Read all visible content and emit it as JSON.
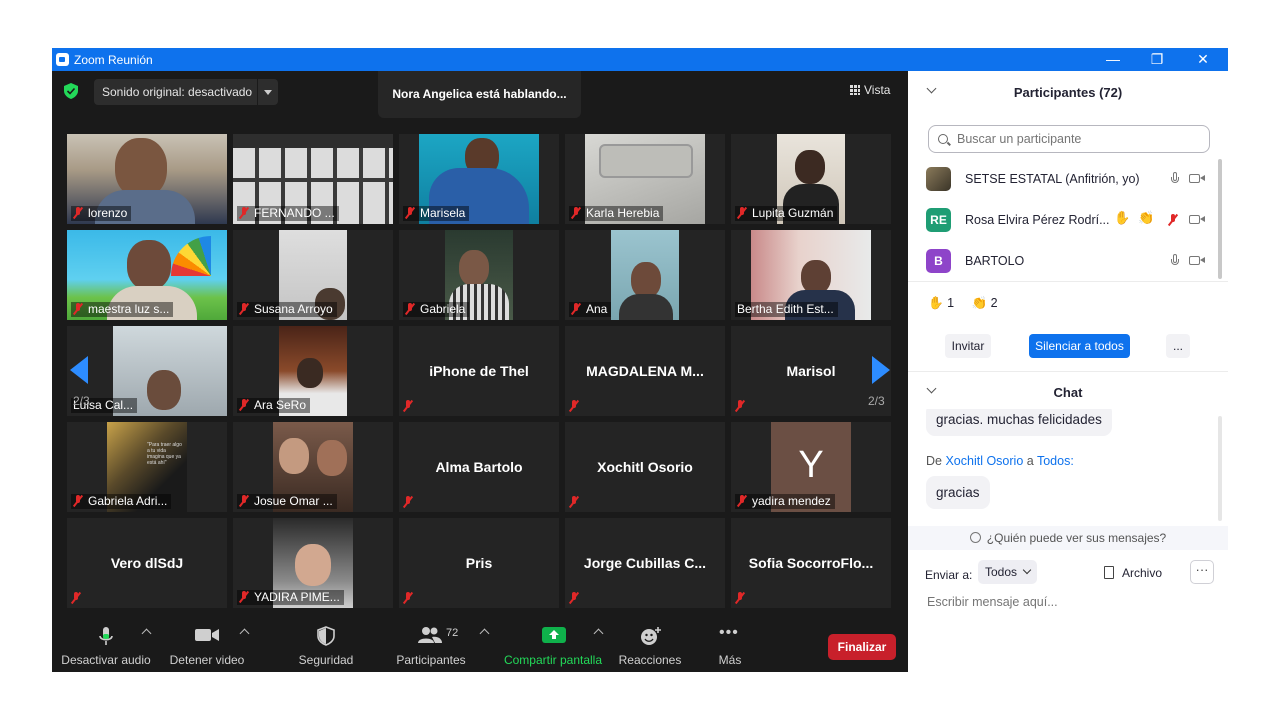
{
  "window": {
    "title": "Zoom Reunión",
    "minimize": "—",
    "restore": "❐",
    "close": "✕"
  },
  "meeting": {
    "original_sound": "Sonido original: desactivado",
    "speaking_banner": "Nora Angelica está hablando...",
    "view_label": "Vista",
    "page_left": "2/3",
    "page_right": "2/3"
  },
  "tiles": [
    {
      "name": "lorenzo"
    },
    {
      "name": "FERNANDO ..."
    },
    {
      "name": "Marisela"
    },
    {
      "name": "Karla Herebia"
    },
    {
      "name": "Lupita Guzmán"
    },
    {
      "name": "maestra luz s..."
    },
    {
      "name": "Susana Arroyo"
    },
    {
      "name": "Gabriela"
    },
    {
      "name": "Ana"
    },
    {
      "name": "Bertha Edith Est..."
    },
    {
      "name": "Luisa Cal..."
    },
    {
      "name": "Ara SeRo"
    },
    {
      "name": "iPhone de Thel"
    },
    {
      "name": "MAGDALENA M..."
    },
    {
      "name": "Marisol"
    },
    {
      "name": "Gabriela Adri..."
    },
    {
      "name": "Josue Omar ..."
    },
    {
      "name": "Alma Bartolo"
    },
    {
      "name": "Xochitl Osorio"
    },
    {
      "name": "yadira mendez",
      "initial": "Y"
    },
    {
      "name": "Vero dlSdJ"
    },
    {
      "name": "YADIRA PIME..."
    },
    {
      "name": "Pris"
    },
    {
      "name": "Jorge Cubillas C..."
    },
    {
      "name": "Sofia SocorroFlo..."
    }
  ],
  "toolbar": {
    "audio": "Desactivar audio",
    "video": "Detener video",
    "security": "Seguridad",
    "participants": "Participantes",
    "participants_count": "72",
    "share": "Compartir pantalla",
    "reactions": "Reacciones",
    "more": "Más",
    "end": "Finalizar"
  },
  "participants_panel": {
    "title": "Participantes (72)",
    "search_placeholder": "Buscar un participante",
    "rows": [
      {
        "name": "SETSE ESTATAL (Anfitrión, yo)",
        "initials": "",
        "color": "#6b5a45"
      },
      {
        "name": "Rosa Elvira Pérez Rodrí...",
        "initials": "RE",
        "color": "#1f9d74"
      },
      {
        "name": "BARTOLO",
        "initials": "B",
        "color": "#8e44c9"
      }
    ],
    "hands_count": "1",
    "clap_count": "2",
    "invite": "Invitar",
    "mute_all": "Silenciar a todos",
    "more": "..."
  },
  "chat": {
    "title": "Chat",
    "msg1": "gracias. muchas felicidades",
    "from_prefix": "De",
    "from_name": "Xochitl Osorio",
    "to_word": "a",
    "to_name": "Todos:",
    "msg2": "gracias",
    "who_can_see": "¿Quién puede ver sus mensajes?",
    "send_to": "Enviar a:",
    "recipient": "Todos",
    "file": "Archivo",
    "more": "···",
    "input_placeholder": "Escribir mensaje aquí..."
  },
  "colors": {
    "accent": "#0e72ed",
    "arrow": "#2d8cff",
    "end": "#c8202b",
    "share": "#0fb14b",
    "mute": "#e02828"
  }
}
